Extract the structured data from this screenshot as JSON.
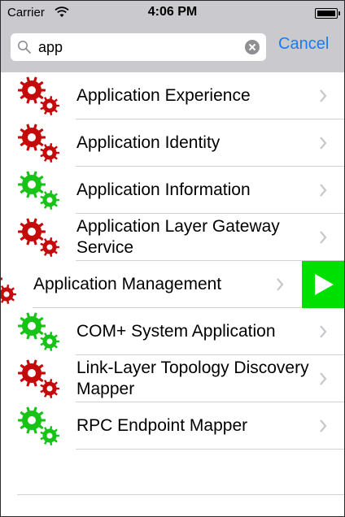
{
  "status_bar": {
    "carrier": "Carrier",
    "time": "4:06 PM",
    "wifi_icon": "wifi-icon",
    "battery_icon": "battery-icon"
  },
  "search": {
    "value": "app",
    "placeholder": "",
    "cancel_label": "Cancel",
    "search_icon": "search-icon",
    "clear_icon": "clear-icon"
  },
  "colors": {
    "running": "#18c318",
    "stopped": "#c40a0a",
    "accent": "#1a7cf0",
    "action_green": "#00e000"
  },
  "services": [
    {
      "name": "Application Experience",
      "status": "stopped"
    },
    {
      "name": "Application Identity",
      "status": "stopped"
    },
    {
      "name": "Application Information",
      "status": "running"
    },
    {
      "name": "Application Layer Gateway Service",
      "status": "stopped"
    },
    {
      "name": "Application Management",
      "status": "stopped",
      "swiped": true,
      "swipe_action": "start",
      "swipe_icon": "play-icon"
    },
    {
      "name": "COM+ System Application",
      "status": "running"
    },
    {
      "name": "Link-Layer Topology Discovery Mapper",
      "status": "stopped"
    },
    {
      "name": "RPC Endpoint Mapper",
      "status": "running"
    }
  ]
}
